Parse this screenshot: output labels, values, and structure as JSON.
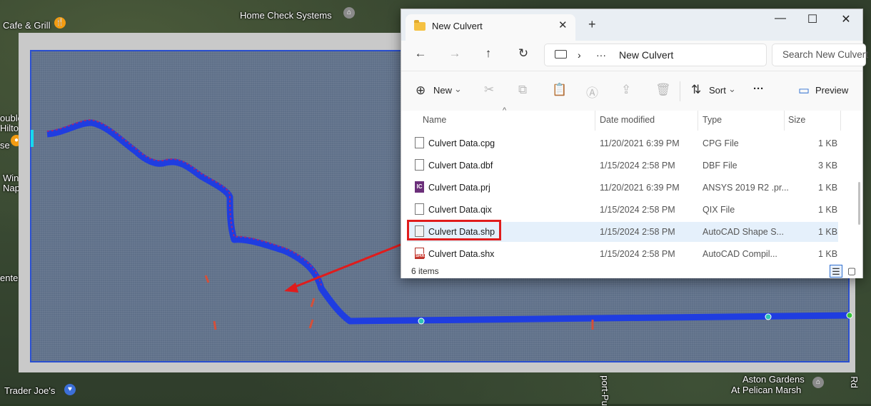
{
  "map": {
    "labels": [
      {
        "text": "Cafe & Grill"
      },
      {
        "text": "Home Check Systems"
      },
      {
        "text": "Trader Joe's"
      },
      {
        "text": "Aston Gardens"
      },
      {
        "text": "At Pelican Marsh"
      },
      {
        "text": "ouble"
      },
      {
        "text": "Hilto"
      },
      {
        "text": "se"
      },
      {
        "text": "Win"
      },
      {
        "text": "Nap"
      },
      {
        "text": "enter"
      },
      {
        "text": "Rd"
      },
      {
        "text": "port-Pu"
      }
    ]
  },
  "explorer": {
    "tab_title": "New Culvert",
    "tab_close": "✕",
    "new_tab": "+",
    "window_controls": {
      "minimize": "—",
      "maximize": "☐",
      "close": "✕"
    },
    "nav": {
      "back": "←",
      "forward": "→",
      "up": "↑",
      "refresh": "↻"
    },
    "breadcrumb": {
      "separator": "›",
      "more": "···",
      "current": "New Culvert"
    },
    "search_placeholder": "Search New Culvert",
    "commands": {
      "new_label": "New",
      "new_icon": "⊕",
      "new_chevron": "⌄",
      "sort_label": "Sort",
      "sort_chevron": "⌄",
      "sort_icon": "⇅",
      "more_label": "···",
      "preview_label": "Preview",
      "icons": {
        "cut": "✂",
        "copy": "⧉",
        "paste": "📋",
        "rename": "Ⓐ",
        "share": "⇪",
        "delete": "🗑",
        "preview": "▭"
      }
    },
    "columns": [
      "Name",
      "Date modified",
      "Type",
      "Size"
    ],
    "sort_arrow": "^",
    "files": [
      {
        "name": "Culvert Data.cpg",
        "date": "11/20/2021 6:39 PM",
        "type": "CPG File",
        "size": "1 KB",
        "icon": "file-icon"
      },
      {
        "name": "Culvert Data.dbf",
        "date": "1/15/2024 2:58 PM",
        "type": "DBF File",
        "size": "3 KB",
        "icon": "file-icon"
      },
      {
        "name": "Culvert Data.prj",
        "date": "11/20/2021 6:39 PM",
        "type": "ANSYS 2019 R2 .pr...",
        "size": "1 KB",
        "icon": "ansys-icon",
        "icon_text": "IC"
      },
      {
        "name": "Culvert Data.qix",
        "date": "1/15/2024 2:58 PM",
        "type": "QIX File",
        "size": "1 KB",
        "icon": "file-icon"
      },
      {
        "name": "Culvert Data.shp",
        "date": "1/15/2024 2:58 PM",
        "type": "AutoCAD Shape S...",
        "size": "1 KB",
        "icon": "shape-file-icon",
        "selected": true
      },
      {
        "name": "Culvert Data.shx",
        "date": "1/15/2024 2:58 PM",
        "type": "AutoCAD Compil...",
        "size": "1 KB",
        "icon": "shx-file-icon"
      }
    ],
    "status": "6 items",
    "view_details": "☰",
    "view_tiles": "▢"
  },
  "colors": {
    "highlight_box": "#e01c1c",
    "arrow": "#e01c1c",
    "culvert_path": "#1f3de0",
    "terrain_border": "#2a4fcf",
    "selection": "#e5f0fb"
  }
}
